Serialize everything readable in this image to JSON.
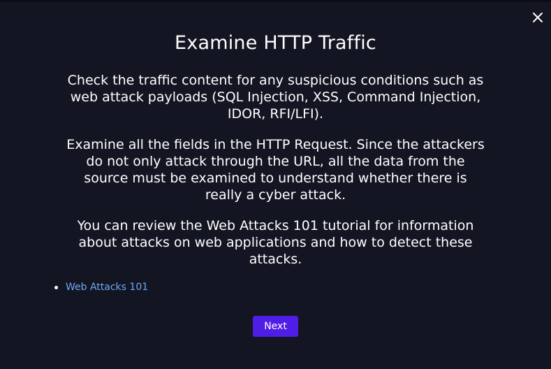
{
  "modal": {
    "title": "Examine HTTP Traffic",
    "paragraphs": [
      "Check the traffic content for any suspicious conditions such as web attack payloads (SQL Injection, XSS, Command Injection, IDOR, RFI/LFI).",
      "Examine all the fields in the HTTP Request. Since the attackers do not only attack through the URL, all the data from the source must be examined to understand whether there is really a cyber attack.",
      "You can review the Web Attacks 101 tutorial for information about attacks on web applications and how to detect these attacks."
    ],
    "links": [
      {
        "label": "Web Attacks 101"
      }
    ],
    "next_label": "Next",
    "close_icon": "close-icon"
  },
  "colors": {
    "background": "#131522",
    "text": "#ffffff",
    "link": "#6eaaf5",
    "primary_button": "#4f1ee6"
  }
}
